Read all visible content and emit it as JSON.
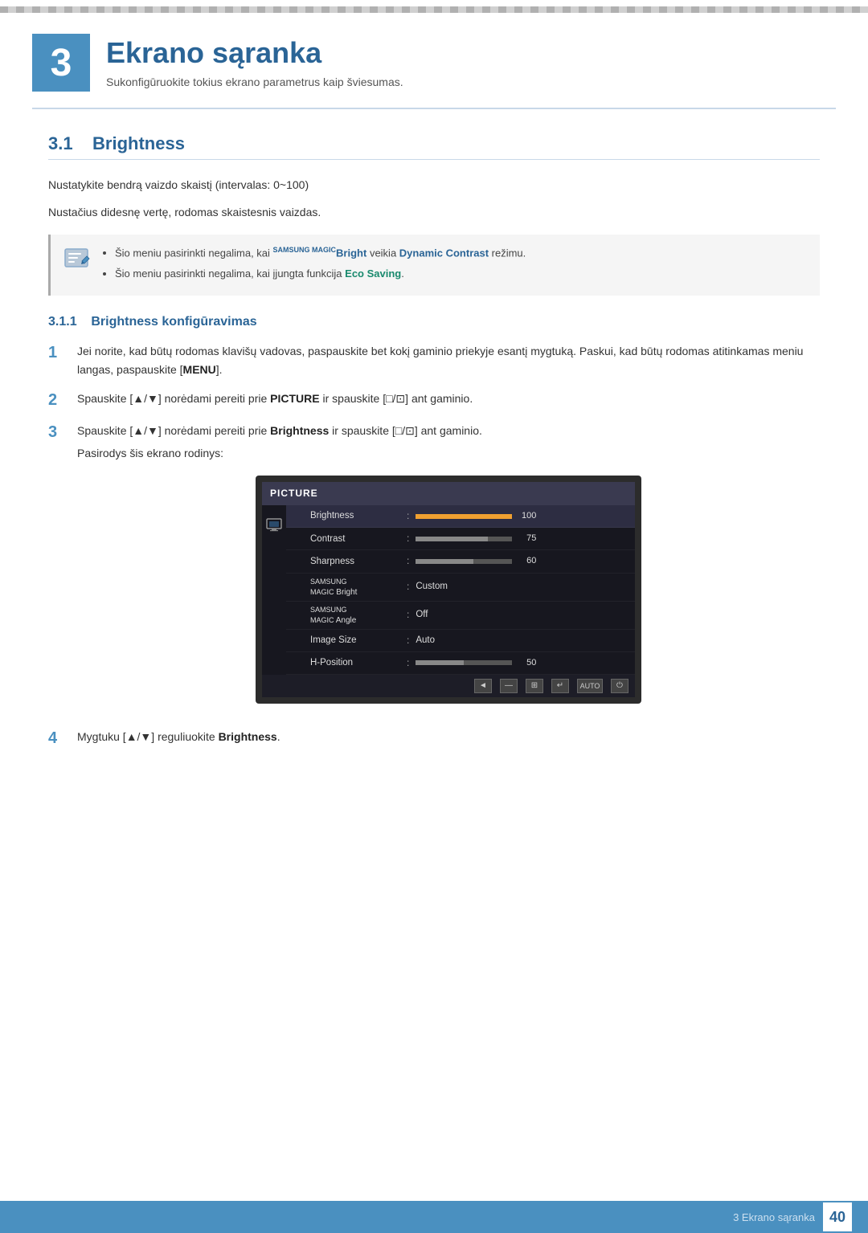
{
  "page": {
    "topStripe": true,
    "chapterNumber": "3",
    "chapterTitle": "Ekrano sąranka",
    "chapterSubtitle": "Sukonfigūruokite tokius ekrano parametrus kaip šviesumas.",
    "sectionNumber": "3.1",
    "sectionTitle": "Brightness",
    "bodyText1": "Nustatykite bendrą vaizdo skaistį (intervalas: 0~100)",
    "bodyText2": "Nustačius didesnę vertę, rodomas skaistesnis vaizdas.",
    "note1": "Šio meniu pasirinkti negalima, kai ",
    "note1_brand": "SAMSUNG MAGIC",
    "note1_bright": "Bright",
    "note1_mid": " veikia ",
    "note1_highlight": "Dynamic Contrast",
    "note1_end": " režimu.",
    "note2_start": "Šio meniu pasirinkti negalima, kai įjungta funkcija ",
    "note2_highlight": "Eco Saving",
    "note2_end": ".",
    "subsectionNumber": "3.1.1",
    "subsectionTitle": "Brightness konfigūravimas",
    "steps": [
      {
        "number": "1",
        "text": "Jei norite, kad būtų rodomas klavišų vadovas, paspauskite bet kokį gaminio priekyje esantį mygtuką. Paskui, kad būtų rodomas atitinkamas meniu langas, paspauskite [",
        "kbd1": "MENU",
        "text2": "]."
      },
      {
        "number": "2",
        "text": "Spauskite [▲/▼] norėdami pereiti prie ",
        "bold": "PICTURE",
        "text2": " ir spauskite [□/⊡] ant gaminio."
      },
      {
        "number": "3",
        "text": "Spauskite [▲/▼] norėdami pereiti prie ",
        "bold": "Brightness",
        "text2": " ir spauskite [□/⊡] ant gaminio.",
        "subtext": "Pasirodys šis ekrano rodinys:"
      },
      {
        "number": "4",
        "text": "Mygtuku [▲/▼] reguliuokite ",
        "bold": "Brightness",
        "text2": "."
      }
    ],
    "osd": {
      "title": "PICTURE",
      "items": [
        {
          "label": "Brightness",
          "type": "bar",
          "fill": "full",
          "value": "100",
          "selected": true
        },
        {
          "label": "Contrast",
          "type": "bar",
          "fill": "p75",
          "value": "75",
          "selected": false
        },
        {
          "label": "Sharpness",
          "type": "bar",
          "fill": "p60",
          "value": "60",
          "selected": false
        },
        {
          "label": "SAMSUNG\nMAGIC Bright",
          "type": "text",
          "value": "Custom",
          "selected": false
        },
        {
          "label": "SAMSUNG\nMAGIC Angle",
          "type": "text",
          "value": "Off",
          "selected": false
        },
        {
          "label": "Image Size",
          "type": "text",
          "value": "Auto",
          "selected": false
        },
        {
          "label": "H-Position",
          "type": "bar",
          "fill": "p50",
          "value": "50",
          "selected": false
        }
      ],
      "controls": [
        "◄",
        "—",
        "⊞",
        "↵",
        "AUTO",
        "⏻"
      ]
    },
    "footer": {
      "text": "3 Ekrano sąranka",
      "pageNumber": "40"
    }
  }
}
